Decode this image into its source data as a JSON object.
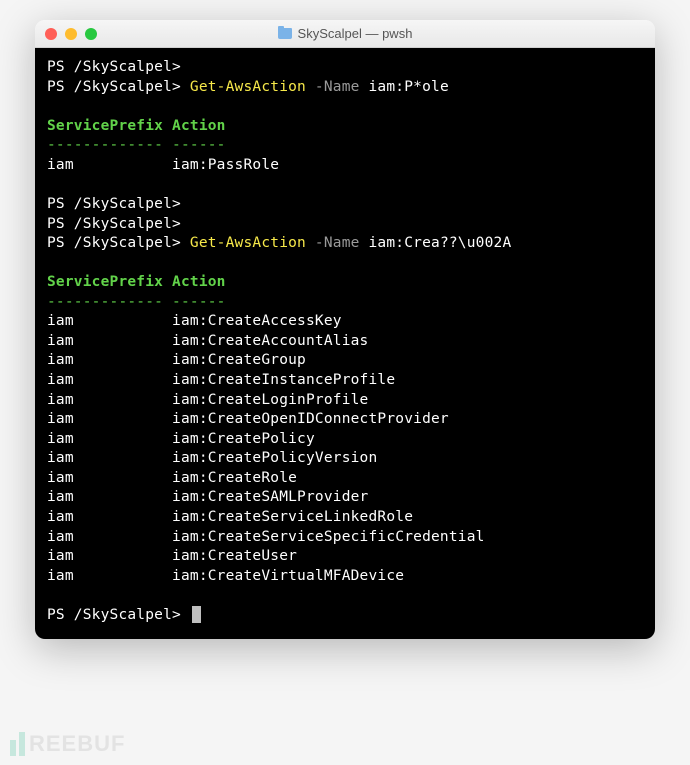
{
  "window": {
    "title": "SkyScalpel — pwsh"
  },
  "prompts": {
    "p1": "PS /SkyScalpel>",
    "p2": "PS /SkyScalpel> ",
    "cmd1": "Get-AwsAction",
    "param1": " -Name ",
    "arg1": "iam:P*ole",
    "p3": "PS /SkyScalpel>",
    "p4": "PS /SkyScalpel>",
    "p5": "PS /SkyScalpel> ",
    "cmd2": "Get-AwsAction",
    "param2": " -Name ",
    "arg2": "iam:Crea??\\u002A",
    "pend": "PS /SkyScalpel> "
  },
  "table1": {
    "h1": "ServicePrefix",
    "h2": "Action",
    "dash1": "-------------",
    "dash2": "------",
    "r1c1": "iam",
    "r1c2": "iam:PassRole"
  },
  "table2": {
    "h1": "ServicePrefix",
    "h2": "Action",
    "dash1": "-------------",
    "dash2": "------",
    "rows": [
      {
        "c1": "iam",
        "c2": "iam:CreateAccessKey"
      },
      {
        "c1": "iam",
        "c2": "iam:CreateAccountAlias"
      },
      {
        "c1": "iam",
        "c2": "iam:CreateGroup"
      },
      {
        "c1": "iam",
        "c2": "iam:CreateInstanceProfile"
      },
      {
        "c1": "iam",
        "c2": "iam:CreateLoginProfile"
      },
      {
        "c1": "iam",
        "c2": "iam:CreateOpenIDConnectProvider"
      },
      {
        "c1": "iam",
        "c2": "iam:CreatePolicy"
      },
      {
        "c1": "iam",
        "c2": "iam:CreatePolicyVersion"
      },
      {
        "c1": "iam",
        "c2": "iam:CreateRole"
      },
      {
        "c1": "iam",
        "c2": "iam:CreateSAMLProvider"
      },
      {
        "c1": "iam",
        "c2": "iam:CreateServiceLinkedRole"
      },
      {
        "c1": "iam",
        "c2": "iam:CreateServiceSpecificCredential"
      },
      {
        "c1": "iam",
        "c2": "iam:CreateUser"
      },
      {
        "c1": "iam",
        "c2": "iam:CreateVirtualMFADevice"
      }
    ]
  },
  "watermark": {
    "text": "REEBUF"
  }
}
